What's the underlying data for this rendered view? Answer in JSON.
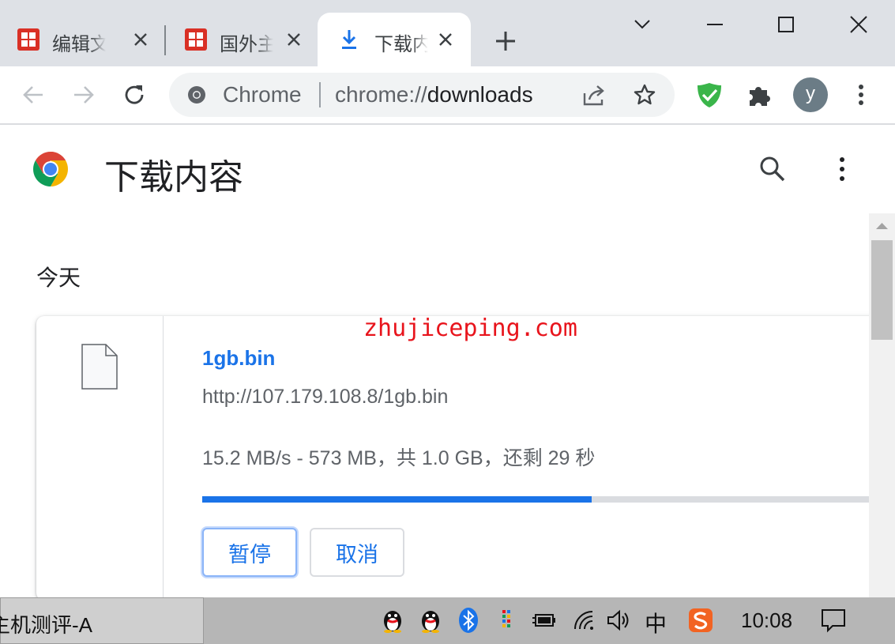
{
  "tabs": [
    {
      "label": "编辑文章",
      "icon": "red-stamp-favicon",
      "active": false
    },
    {
      "label": "国外主机测评",
      "icon": "red-stamp-favicon",
      "active": false
    },
    {
      "label": "下载内容",
      "icon": "download-favicon",
      "active": true
    }
  ],
  "toolbar": {
    "site_chip": "Chrome",
    "url_scheme": "chrome://",
    "url_path": "downloads",
    "avatar_letter": "y"
  },
  "page": {
    "title": "下载内容",
    "date_header": "今天"
  },
  "download": {
    "filename": "1gb.bin",
    "url": "http://107.179.108.8/1gb.bin",
    "status": "15.2 MB/s - 573 MB，共 1.0 GB，还剩 29 秒",
    "progress_fraction": 0.573,
    "pause_label": "暂停",
    "cancel_label": "取消"
  },
  "watermark": "zhujiceping.com",
  "taskbar": {
    "window_label": "主机测评-A",
    "ime": "中",
    "clock": "10:08"
  },
  "colors": {
    "accent": "#1a73e8",
    "tabstrip": "#dee1e6",
    "watermark": "#e8141c"
  }
}
